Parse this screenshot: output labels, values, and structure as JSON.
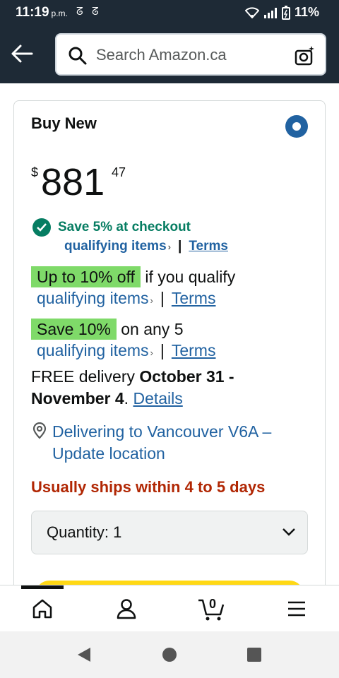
{
  "status_bar": {
    "time": "11:19",
    "ampm": "p.m.",
    "battery": "11%"
  },
  "search": {
    "placeholder": "Search Amazon.ca"
  },
  "offer": {
    "heading": "Buy New",
    "price_currency": "$",
    "price_whole": "881",
    "price_fraction": "47",
    "save_checkout": "Save 5% at checkout",
    "qualifying_items": "qualifying items",
    "terms": "Terms",
    "separator": "|",
    "promo1_badge": "Up to 10% off",
    "promo1_text": "if you qualify",
    "promo2_badge": "Save 10%",
    "promo2_text": "on any 5",
    "delivery_prefix": "FREE delivery",
    "delivery_dates": "October 31 - November 4",
    "delivery_period": ".",
    "details_link": "Details",
    "location_line1": "Delivering to Vancouver V6A –",
    "location_line2": "Update location",
    "ships": "Usually ships within 4 to 5 days",
    "quantity_label": "Quantity: 1"
  },
  "bottom_nav": {
    "cart_count": "0",
    "items": [
      "home-icon",
      "account-icon",
      "cart-icon",
      "menu-icon"
    ]
  },
  "colors": {
    "header_bg": "#1e2a36",
    "link": "#2162a1",
    "success": "#067d62",
    "badge": "#7fda69",
    "ships": "#b12704",
    "buy_button": "#ffd814"
  }
}
